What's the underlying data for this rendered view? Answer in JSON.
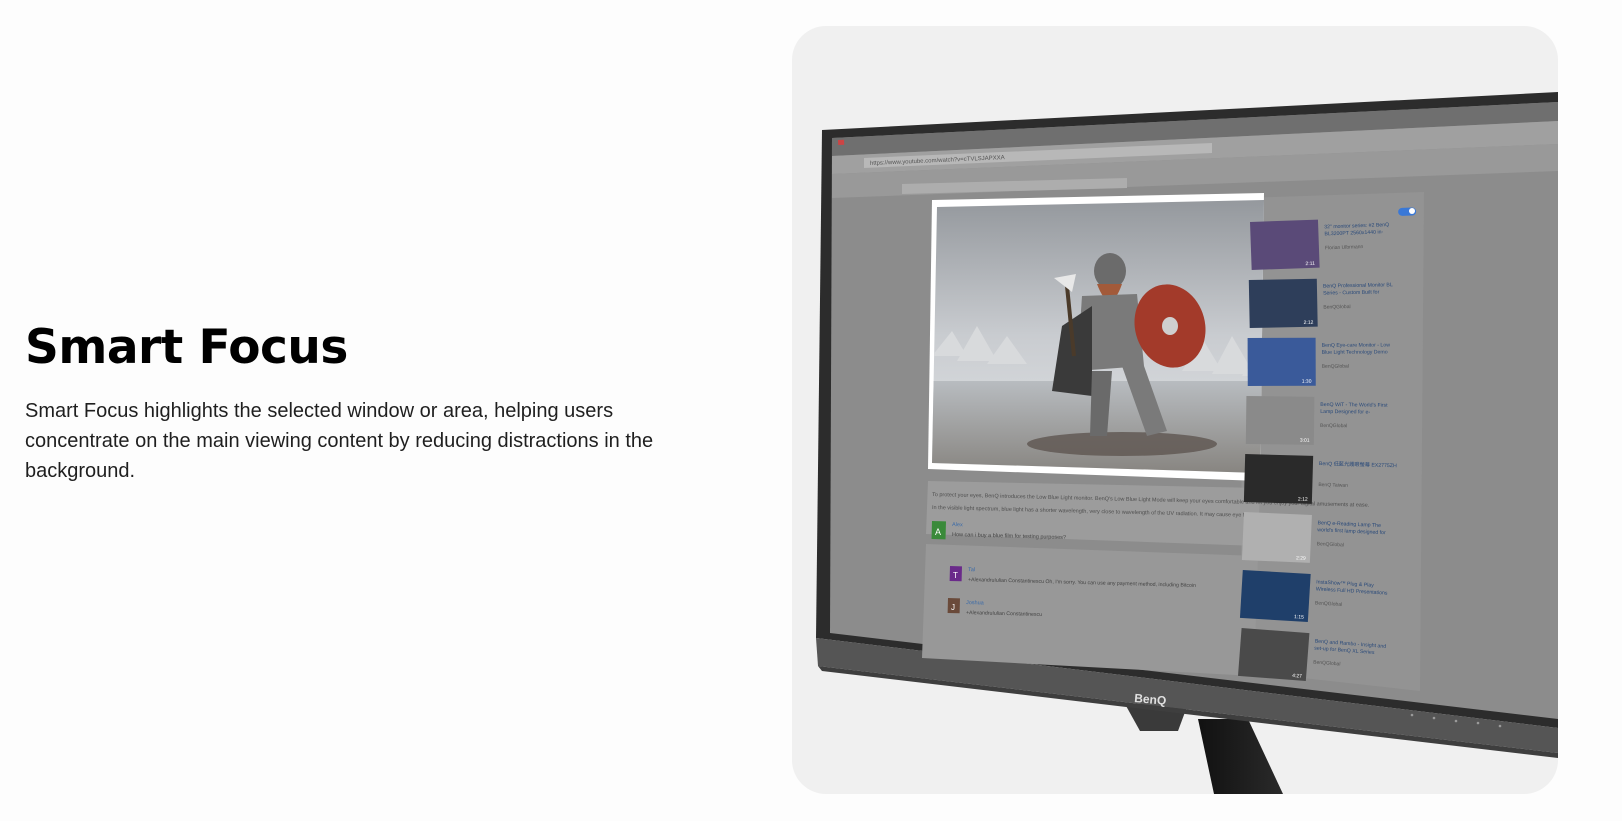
{
  "section": {
    "title": "Smart Focus",
    "description": "Smart Focus highlights the selected window or area, helping users concentrate on the main viewing content by reducing distractions in the background."
  },
  "monitor": {
    "brand": "BenQ",
    "url": "https://www.youtube.com/watch?v=cTVLSJAPXXA",
    "smart_focus_toggle": true,
    "video_description": "To protect your eyes, BenQ introduces the Low Blue Light monitor. BenQ's Low Blue Light Mode will keep your eyes comfortable and let you enjoy your digital amusements at ease.",
    "video_description_2": "In the visible light spectrum, blue light has a shorter wavelength, very close to wavelength of the UV radiation. It may cause eye fatigue and",
    "comments": [
      {
        "initial": "A",
        "author": "Alex",
        "text": "How can i buy a blue film for testing purposes?"
      },
      {
        "initial": "T",
        "author": "Tal",
        "text": "+AlexandruIulian Constantinescu Oh, I'm sorry. You can use any payment method, including Bitcoin"
      },
      {
        "initial": "J",
        "author": "Joshua",
        "text": "+AlexandruIulian Constantinescu"
      }
    ],
    "sidebar_videos": [
      {
        "title": "32\" monitor series: #2 BenQ BL3200PT 2560x1440 in-",
        "channel": "Florian Ulbrmann",
        "duration": "2:11"
      },
      {
        "title": "BenQ Professional Monitor BL Series - Custom Built for",
        "channel": "BenQGlobal",
        "duration": "2:12"
      },
      {
        "title": "BenQ Eye-care Monitor - Low Blue Light Technology Demo",
        "channel": "BenQGlobal",
        "duration": "1:30"
      },
      {
        "title": "BenQ WiT - The World's First Lamp Designed for e-",
        "channel": "BenQGlobal",
        "duration": "3:01"
      },
      {
        "title": "BenQ 低藍光護眼螢幕 EX2775ZH",
        "channel": "BenQ Taiwan",
        "duration": "2:12"
      },
      {
        "title": "BenQ e-Reading Lamp The world's first lamp designed for",
        "channel": "BenQGlobal",
        "duration": "2:29"
      },
      {
        "title": "InstaShow™ Plug & Play Wireless Full HD Presentations",
        "channel": "BenQGlobal",
        "duration": "1:15"
      },
      {
        "title": "BenQ and Rambo - Insight and set-up for BenQ XL Series",
        "channel": "BenQGlobal",
        "duration": "4:27"
      }
    ],
    "colors": {
      "card_bg": "#f0f0f0",
      "bezel": "#2c2c2c",
      "dimmed_screen": "#8c8c8c",
      "highlight_accent": "#3a78d6"
    }
  }
}
